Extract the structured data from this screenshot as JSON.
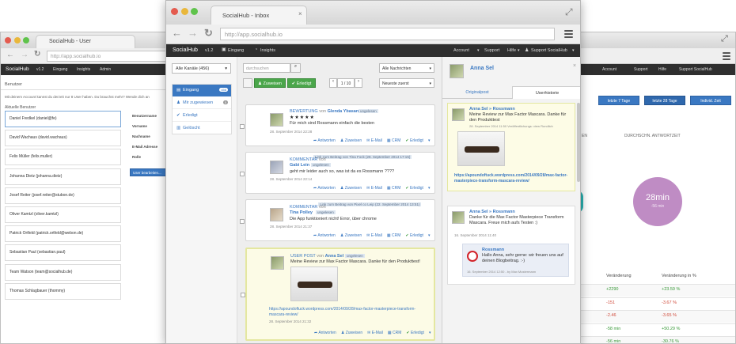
{
  "user_window": {
    "tab_title": "SocialHub - User",
    "url": "http://app.socialhub.io",
    "app": {
      "name": "SocialHub",
      "version": "v1.2",
      "nav": [
        "Eingang",
        "Insights",
        "Admin"
      ]
    },
    "section": "Benutzer",
    "notice": "Mit deinem Account kannst du derzeit nur 8 User haben. Du brauchst mehr? Wende dich an",
    "list_title": "Aktuelle Benutzer",
    "users": [
      "Daniel Fredkel (daniel@fe)",
      "David Wachaus (david.wachaus)",
      "Felix Müller (felix.muller)",
      "Johanna Dietz (johanna.dietz)",
      "Josef Reiter (josef.reiter@stubon.de)",
      "Oliver Kamtzl (oliver.kamtzl)",
      "Patrick Ortfeld (patrick.ortfeld@webon.de)",
      "Sebastian Paul (sebastian.paul)",
      "Team Watson (team@socialhub.de)",
      "Thomas Schlagbauer (thommy)"
    ],
    "form_labels": [
      "Benutzername",
      "Vorname",
      "Nachname",
      "E-Mail Adresse",
      "Rolle"
    ],
    "edit_button": "User bearbeiten..."
  },
  "stats_window": {
    "app_nav": [
      "Account",
      "Support",
      "Hilfe",
      "Support SocialHub"
    ],
    "ranges": [
      "letzte 7 Tage",
      "letzte 28 Tage",
      "Individ. Zeit"
    ],
    "left_metric_label": "EN",
    "metric_label": "DURCHSCHN. ANTWORTZEIT",
    "metric_value": "28min",
    "metric_sub": "-56 min",
    "table_headers": [
      "Veränderung",
      "Veränderung in %"
    ],
    "rows": [
      {
        "abs": "+2290",
        "pct": "+23.59 %",
        "pos": true
      },
      {
        "abs": "-151",
        "pct": "-3.67 %",
        "pos": false
      },
      {
        "abs": "-2.46",
        "pct": "-3.65 %",
        "pos": false
      },
      {
        "abs": "-58 min",
        "pct": "+50.29 %",
        "pos": true
      },
      {
        "abs": "-56 min",
        "pct": "-30.76 %",
        "pos": true
      }
    ]
  },
  "inbox": {
    "tab_title": "SocialHub - Inbox",
    "url": "http://app.socialhub.io",
    "app": {
      "name": "SocialHub",
      "version": "v1.2",
      "nav": [
        "Eingang",
        "Insights"
      ],
      "right": [
        "Account",
        "Support",
        "Hilfe",
        "Support SocialHub"
      ]
    },
    "channel_select": "Alle Kanäle (456)",
    "folders": [
      {
        "label": "Eingang",
        "count": "456",
        "active": true
      },
      {
        "label": "Mir zugewiesen",
        "count": "5"
      },
      {
        "label": "Erledigt",
        "count": ""
      },
      {
        "label": "Gelöscht",
        "count": ""
      }
    ],
    "search_placeholder": "durchsuchen",
    "filter": "Alle Nachrichten",
    "sort": "Neueste zuerst",
    "assign_btn": "Zuweisen",
    "done_btn": "Erledigt",
    "pager": "1 / 10",
    "actions": [
      "Antworten",
      "Zuweisen",
      "E-Mail",
      "CRM",
      "Erledigt"
    ],
    "messages": [
      {
        "type": "BEWERTUNG",
        "from": "Glenda Ybasan",
        "tag": "ungelesen",
        "stars": "★★★★★",
        "text": "Für mich sind Rossmann einfach die besten",
        "date": "28. September 2014 22:28"
      },
      {
        "type": "KOMMENTAR",
        "from": "Gabi Lein",
        "tag": "ungelesen",
        "link": "Link zum Beitrag von Tina Fock (28. September 2014 17:15)",
        "text": "geht mir leider auch so, was ist da es Rossmann ????",
        "date": "28. September 2014 22:14"
      },
      {
        "type": "KOMMENTAR",
        "from": "Tina Polley",
        "tag": "ungelesen",
        "link": "Link zum Beitrag von Pixel co Leip (22. September 2014 13:51)",
        "text": "Die App funktioniert nicht! Error, über chrome",
        "date": "28. September 2014 21:37"
      },
      {
        "type": "USER POST",
        "from": "Anna Sel",
        "tag": "ungelesen",
        "text": "Meine Review zur Max Factor Mascara. Danke für den Produkttest!",
        "url": "https://apoundoftuck.wordpress.com/2014/09/28/max-factor-masterpiece-transform-mascara-review/",
        "date": "28. September 2014 21:32"
      }
    ],
    "detail": {
      "name": "Anna Sel",
      "tabs": [
        "Originalpost",
        "Userhistorie"
      ],
      "h1_head": "Anna Sel » Rossmann",
      "h1_text": "Meine Review zur Max Factor Mascara. Danke für den Produkttest",
      "h1_date": "28. September 2014 11:50 Veröffentlichungs: view Rundlich",
      "h1_url": "https://apoundoftuck.wordpress.com/2014/09/28/max-factor-masterpiece-transform-mascara-review/",
      "h2_head": "Anna Sel » Rossmann",
      "h2_text": "Danke für die Max Factor Masterpiece Transform Mascara. Freue mich aufs Testen :)",
      "h2_date": "16. September 2014 11:40",
      "reply_head": "Rossmann",
      "reply_text": "Hallo Anna, sehr gerne: wir freuen uns auf deinen Blogbeitrag. :-)",
      "reply_date": "16. September 2014 12:50 - by Max Mustermann"
    }
  }
}
